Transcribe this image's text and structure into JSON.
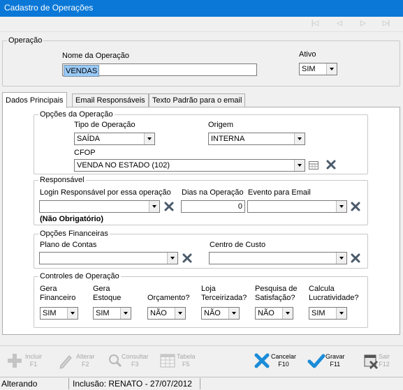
{
  "window": {
    "title": "Cadastro de Operações"
  },
  "operacao": {
    "legend": "Operação",
    "nome_label": "Nome da Operação",
    "nome_value": "VENDAS",
    "ativo_label": "Ativo",
    "ativo_value": "SIM"
  },
  "tabs": [
    {
      "label": "Dados Principais",
      "active": true
    },
    {
      "label": "Email Responsáveis",
      "active": false
    },
    {
      "label": "Texto Padrão para o email",
      "active": false
    }
  ],
  "opcoes": {
    "legend": "Opções da Operação",
    "tipo_label": "Tipo de Operação",
    "tipo_value": "SAÍDA",
    "origem_label": "Origem",
    "origem_value": "INTERNA",
    "cfop_label": "CFOP",
    "cfop_value": "VENDA NO ESTADO (102)"
  },
  "responsavel": {
    "legend": "Responsável",
    "login_label": "Login Responsável por essa operação",
    "login_value": "",
    "dias_label": "Dias na Operação",
    "dias_value": "0",
    "evento_label": "Evento para Email",
    "evento_value": "",
    "nao_obrigatorio": "(Não Obrigatório)"
  },
  "financeiras": {
    "legend": "Opções Financeiras",
    "plano_label": "Plano de Contas",
    "plano_value": "",
    "centro_label": "Centro de Custo",
    "centro_value": ""
  },
  "controles": {
    "legend": "Controles de Operação",
    "items": [
      {
        "label1": "Gera",
        "label2": "Financeiro",
        "value": "SIM"
      },
      {
        "label1": "Gera",
        "label2": "Estoque",
        "value": "SIM"
      },
      {
        "label1": "",
        "label2": "Orçamento?",
        "value": "NÃO"
      },
      {
        "label1": "Loja",
        "label2": "Terceirizada?",
        "value": "NÃO"
      },
      {
        "label1": "Pesquisa de",
        "label2": "Satisfação?",
        "value": "NÃO"
      },
      {
        "label1": "Calcula",
        "label2": "Lucratividade?",
        "value": "SIM"
      }
    ]
  },
  "toolbar": {
    "incluir": {
      "label": "Incluir",
      "key": "F1",
      "icon": "plus-icon",
      "enabled": false
    },
    "alterar": {
      "label": "Alterar",
      "key": "F2",
      "icon": "pencil-icon",
      "enabled": false
    },
    "consultar": {
      "label": "Consultar",
      "key": "F3",
      "icon": "magnifier-icon",
      "enabled": false
    },
    "tabela": {
      "label": "Tabela",
      "key": "F5",
      "icon": "table-icon",
      "enabled": false
    },
    "cancelar": {
      "label": "Cancelar",
      "key": "F10",
      "icon": "cancel-x-icon",
      "enabled": true
    },
    "gravar": {
      "label": "Gravar",
      "key": "F11",
      "icon": "checkmark-icon",
      "enabled": true
    },
    "sair": {
      "label": "Sair",
      "key": "F12",
      "icon": "exit-icon",
      "enabled": false
    }
  },
  "status": {
    "mode": "Alterando",
    "info": "Inclusão: RENATO - 27/07/2012"
  },
  "colors": {
    "titlebar": "#0b78d7",
    "selection": "#99c9f7",
    "x_icon": "#4a5a6a",
    "accent_blue": "#1a8cd8"
  }
}
